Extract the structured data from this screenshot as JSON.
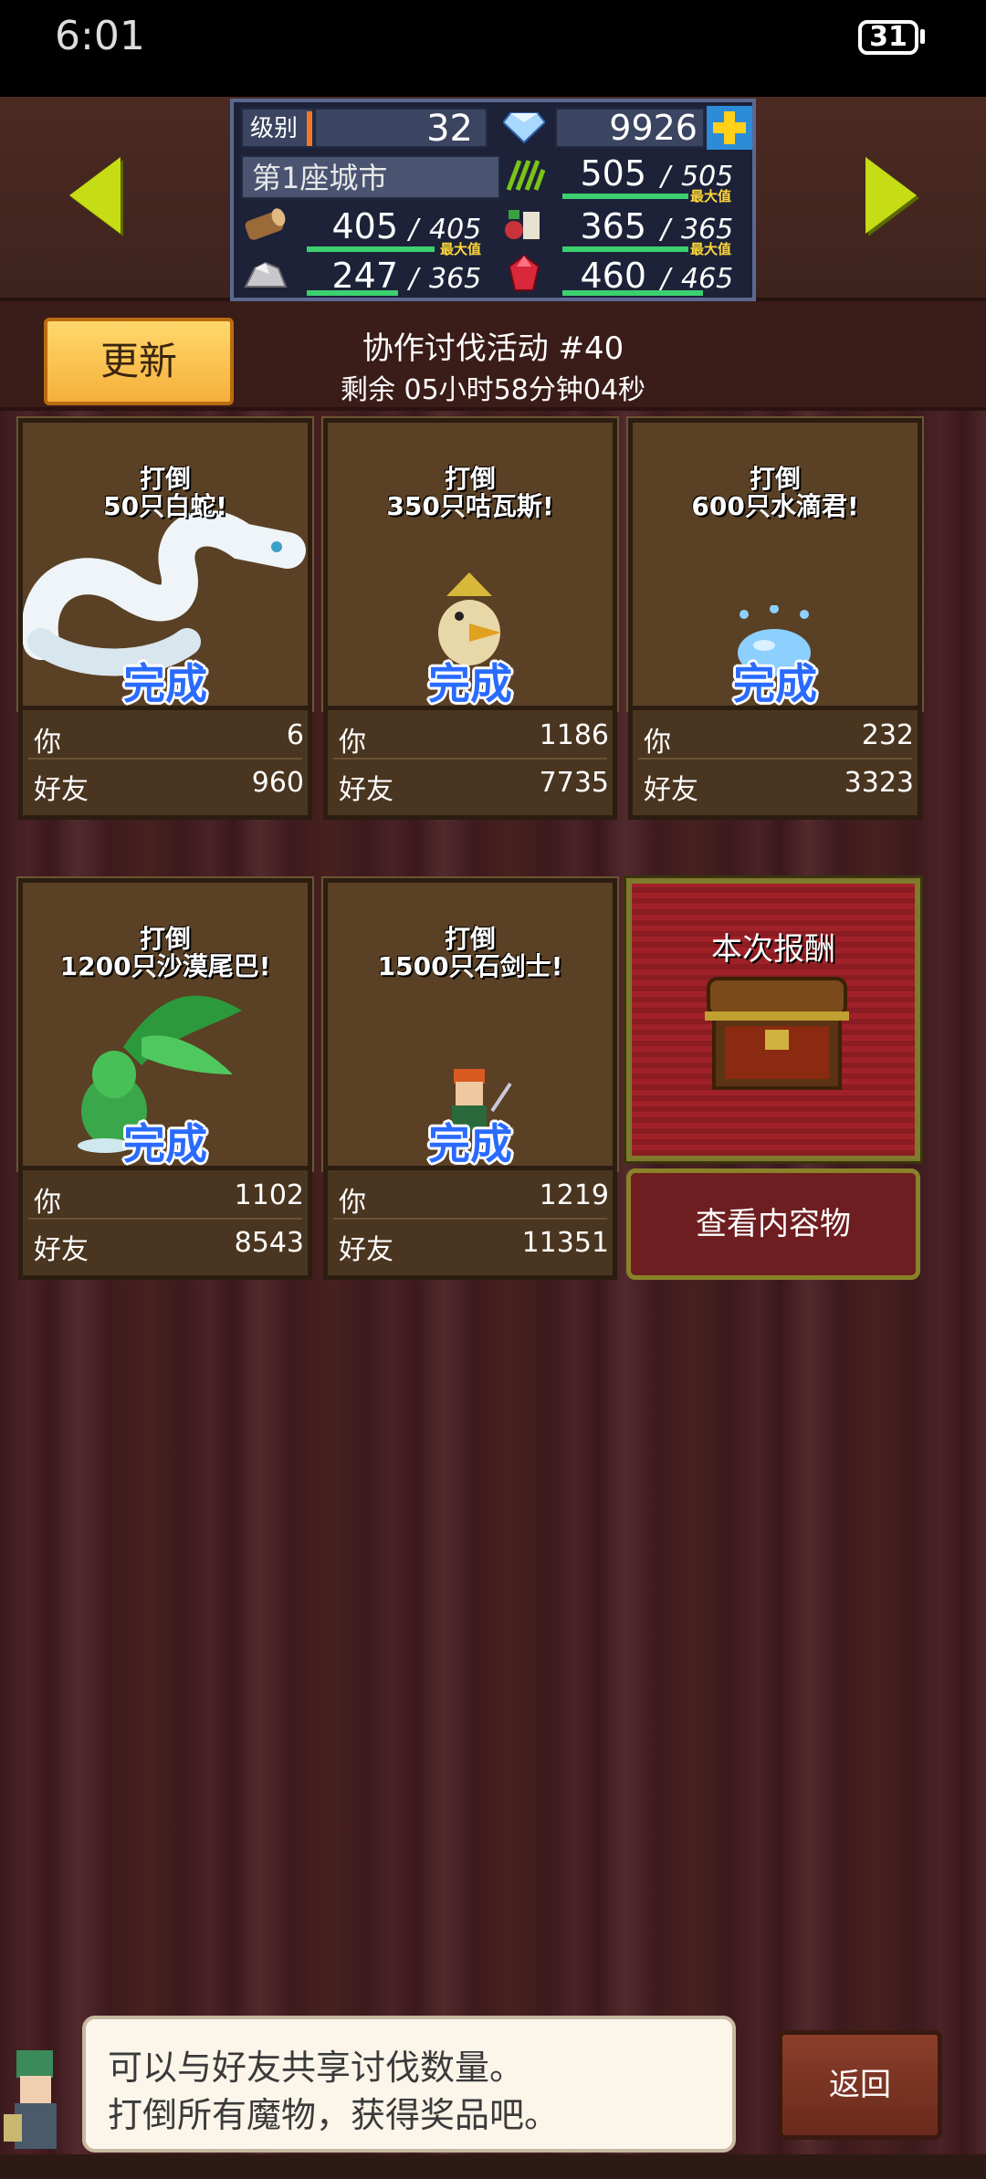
{
  "status_bar": {
    "time": "6:01",
    "battery": "31"
  },
  "stats": {
    "level_label": "级别",
    "level": "32",
    "gems": "9926",
    "city": "第1座城市",
    "grass": {
      "value": "505",
      "max": "505",
      "max_tag": "最大值"
    },
    "wood": {
      "value": "405",
      "max": "405",
      "max_tag": "最大值"
    },
    "food": {
      "value": "365",
      "max": "365",
      "max_tag": "最大值"
    },
    "ore": {
      "value": "247",
      "max": "365"
    },
    "ruby": {
      "value": "460",
      "max": "465"
    },
    "slash": "/"
  },
  "event": {
    "refresh_label": "更新",
    "title": "协作讨伐活动 #40",
    "remaining": "剩余 05小时58分钟04秒"
  },
  "quests": [
    {
      "line1": "打倒",
      "line2": "50只白蛇!",
      "status": "完成",
      "you_label": "你",
      "you": "6",
      "friend_label": "好友",
      "friend": "960"
    },
    {
      "line1": "打倒",
      "line2": "350只咕瓦斯!",
      "status": "完成",
      "you_label": "你",
      "you": "1186",
      "friend_label": "好友",
      "friend": "7735"
    },
    {
      "line1": "打倒",
      "line2": "600只水滴君!",
      "status": "完成",
      "you_label": "你",
      "you": "232",
      "friend_label": "好友",
      "friend": "3323"
    },
    {
      "line1": "打倒",
      "line2": "1200只沙漠尾巴!",
      "status": "完成",
      "you_label": "你",
      "you": "1102",
      "friend_label": "好友",
      "friend": "8543"
    },
    {
      "line1": "打倒",
      "line2": "1500只石剑士!",
      "status": "完成",
      "you_label": "你",
      "you": "1219",
      "friend_label": "好友",
      "friend": "11351"
    }
  ],
  "reward": {
    "title": "本次报酬",
    "button": "查看内容物"
  },
  "dialog": {
    "line1": "可以与好友共享讨伐数量。",
    "line2": "打倒所有魔物，获得奖品吧。",
    "back": "返回"
  },
  "colors": {
    "accent_yellow": "#c6dc14",
    "done_blue": "#2a6bff",
    "refresh_gold": "#f5b03b"
  },
  "icons": [
    "arrow-left-icon",
    "arrow-right-icon",
    "gem-icon",
    "plus-icon",
    "grass-icon",
    "wood-icon",
    "food-icon",
    "ore-icon",
    "ruby-icon",
    "chest-icon"
  ]
}
